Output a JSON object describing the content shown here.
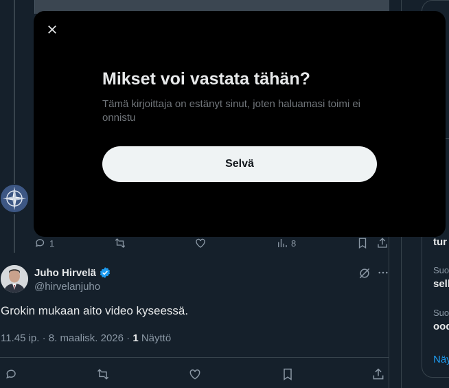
{
  "modal": {
    "title": "Mikset voi vastata tähän?",
    "body": "Tämä kirjoittaja on estänyt sinut, joten haluamasi toimi ei onnistu",
    "button_label": "Selvä"
  },
  "prev_tweet": {
    "reply_count": "1",
    "views": "8"
  },
  "tweet": {
    "name": "Juho Hirvelä",
    "handle": "@hirvelanjuho",
    "text": "Grokin mukaan aito video kyseessä.",
    "timestamp": "11.45 ip. · 8. maalisk. 2026 · ",
    "view_count": "1",
    "view_label": " Näyttö"
  },
  "right_sidebar": {
    "item1_text": "tur",
    "item2_label": "Suo",
    "item2_text": "sell",
    "item3_label": "Suo",
    "item3_text": "ood",
    "show_more": "Näy"
  },
  "colors": {
    "background": "#15202b",
    "modal": "#000000",
    "accent": "#1d9bf0",
    "verified": "#1d9bf0"
  }
}
